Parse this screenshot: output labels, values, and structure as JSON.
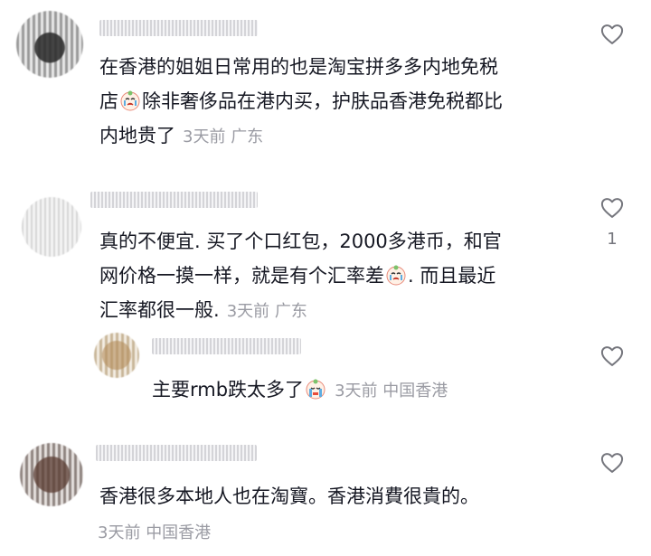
{
  "comments": [
    {
      "text_lines": [
        "在香港的姐姐日常用的也是淘宝拼多多内地免税",
        "店",
        "除非奢侈品在港内买，护肤品香港免税都比",
        "内地贵了"
      ],
      "time": "3天前",
      "location": "广东",
      "likes": ""
    },
    {
      "text_lines": [
        "真的不便宜. 买了个口红包，2000多港币，和官",
        "网价格一摸一样，就是有个汇率差",
        ". 而且最近",
        "汇率都很一般."
      ],
      "time": "3天前",
      "location": "广东",
      "likes": "1"
    },
    {
      "text_lines": [
        "主要rmb跌太多了"
      ],
      "time": "3天前",
      "location": "中国香港",
      "likes": ""
    },
    {
      "text_lines": [
        "香港很多本地人也在淘寶。香港消費很貴的。"
      ],
      "time": "3天前",
      "location": "中国香港",
      "likes": ""
    }
  ],
  "colors": {
    "text": "#161823",
    "meta": "#9a9ba3",
    "icon": "#75767d"
  },
  "icons": {
    "like": "heart-outline-icon",
    "emoji_cry": "crying-face-emoji",
    "emoji_sob": "sobbing-face-emoji"
  }
}
